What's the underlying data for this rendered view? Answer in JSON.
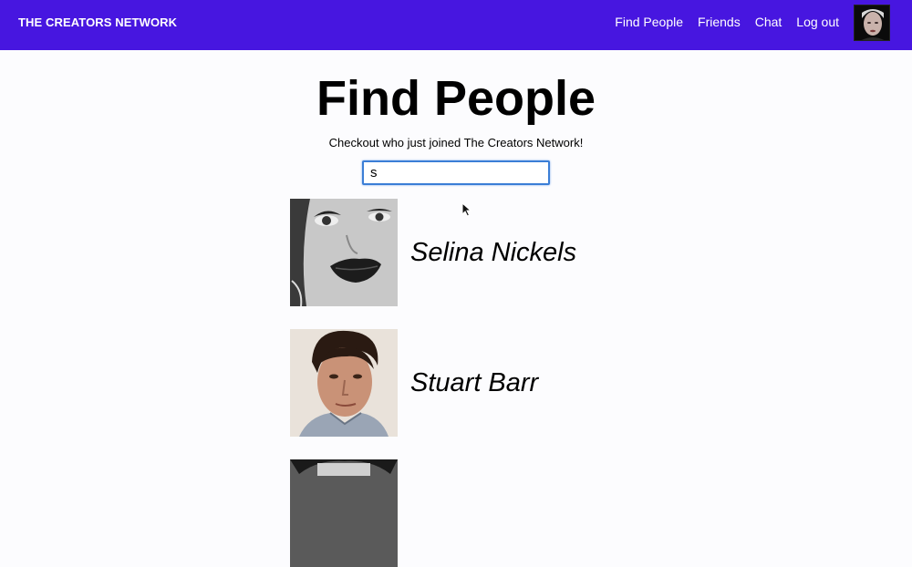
{
  "header": {
    "brand": "THE CREATORS NETWORK",
    "nav": [
      "Find People",
      "Friends",
      "Chat",
      "Log out"
    ],
    "accent_color": "#4716e0"
  },
  "main": {
    "title": "Find People",
    "subtitle": "Checkout who just joined The Creators Network!",
    "search": {
      "value": "s"
    },
    "results": [
      {
        "name": "Selina Nickels",
        "photo_icon": "woman-portrait"
      },
      {
        "name": "Stuart Barr",
        "photo_icon": "man-portrait"
      },
      {
        "name": "",
        "photo_icon": "partial-portrait"
      }
    ]
  }
}
